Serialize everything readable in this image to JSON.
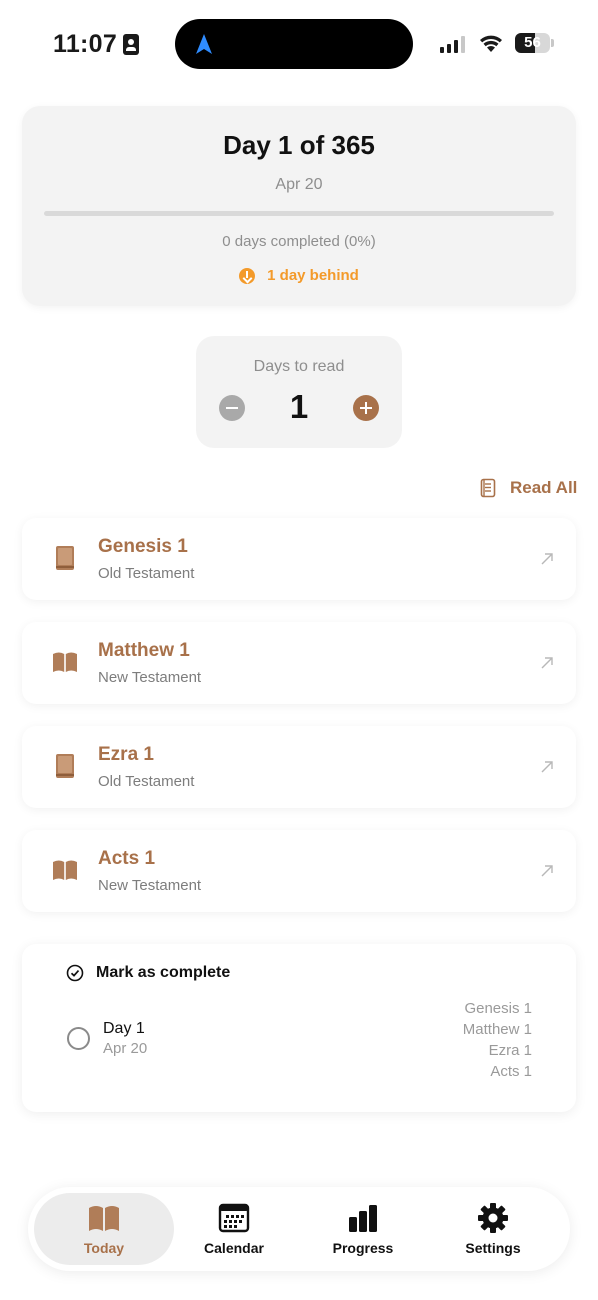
{
  "status_bar": {
    "time": "11:07",
    "battery": "56",
    "battery_level": 0.56
  },
  "header": {
    "day_title": "Day 1 of 365",
    "date": "Apr 20",
    "progress_fraction": 0.0,
    "completed_text": "0 days completed (0%)",
    "behind_text": "1 day behind"
  },
  "days_to_read": {
    "label": "Days to read",
    "value": "1"
  },
  "read_all_label": "Read All",
  "chapters": [
    {
      "title": "Genesis 1",
      "testament": "Old Testament",
      "icon": "closed-book-icon"
    },
    {
      "title": "Matthew 1",
      "testament": "New Testament",
      "icon": "open-book-icon"
    },
    {
      "title": "Ezra 1",
      "testament": "Old Testament",
      "icon": "closed-book-icon"
    },
    {
      "title": "Acts 1",
      "testament": "New Testament",
      "icon": "open-book-icon"
    }
  ],
  "mark_complete": {
    "heading": "Mark as complete",
    "entry": {
      "day": "Day 1",
      "date": "Apr 20",
      "readings": [
        "Genesis 1",
        "Matthew 1",
        "Ezra 1",
        "Acts 1"
      ]
    }
  },
  "tabs": [
    {
      "label": "Today",
      "icon": "open-book-icon",
      "active": true
    },
    {
      "label": "Calendar",
      "icon": "calendar-icon",
      "active": false
    },
    {
      "label": "Progress",
      "icon": "bar-chart-icon",
      "active": false
    },
    {
      "label": "Settings",
      "icon": "gear-icon",
      "active": false
    }
  ],
  "colors": {
    "accent": "#a8714a",
    "warning": "#f39a2a",
    "card_bg": "#f3f3f3",
    "muted_text": "#8e8e8e"
  }
}
